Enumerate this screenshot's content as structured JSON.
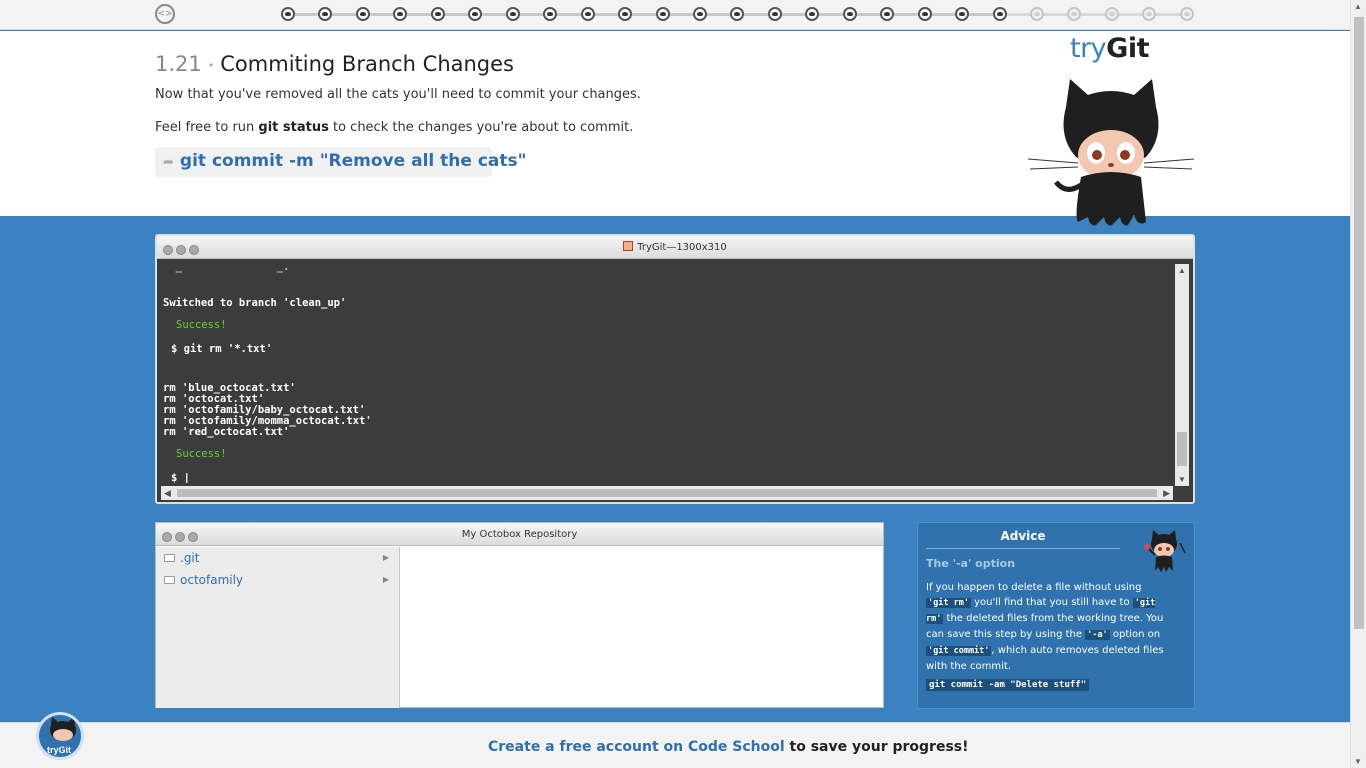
{
  "progress": {
    "total_steps": 25,
    "completed_steps": 20
  },
  "lesson": {
    "number": "1.21",
    "title": "Commiting Branch Changes",
    "paragraph1": "Now that you've removed all the cats you'll need to commit your changes.",
    "paragraph2_before": "Feel free to run ",
    "paragraph2_cmd": "git status",
    "paragraph2_after": " to check the changes you're about to commit.",
    "command": "git commit -m \"Remove all the cats\""
  },
  "logo": {
    "try": "try",
    "git": "Git"
  },
  "terminal": {
    "title": "TryGit—1300x310",
    "lines": [
      "Switched to branch 'clean_up'",
      "Success!",
      "$ git rm '*.txt'",
      "rm 'blue_octocat.txt'",
      "rm 'octocat.txt'",
      "rm 'octofamily/baby_octocat.txt'",
      "rm 'octofamily/momma_octocat.txt'",
      "rm 'red_octocat.txt'",
      "Success!",
      "$ |"
    ]
  },
  "repository": {
    "title": "My Octobox Repository",
    "items": [
      ".git",
      "octofamily"
    ]
  },
  "advice": {
    "title": "Advice",
    "subtitle": "The '-a' option",
    "t1": "If you happen to delete a file without using ",
    "c1": "'git rm'",
    "t2": " you'll find that you still have to ",
    "c2": "'git rm'",
    "t3": " the deleted files from the working tree. You can save this step by using the ",
    "c3": "'-a'",
    "t4": " option on ",
    "c4": "'git commit'",
    "t5": ", which auto removes deleted files with the commit.",
    "command": "git commit -am \"Delete stuff\""
  },
  "footer": {
    "link": "Create a free account on Code School",
    "text": " to save your progress!"
  },
  "badge": {
    "label": "tryGit"
  },
  "colors": {
    "accent": "#3b82c0",
    "success": "#6ccf3a",
    "link": "#2f6fb0"
  }
}
